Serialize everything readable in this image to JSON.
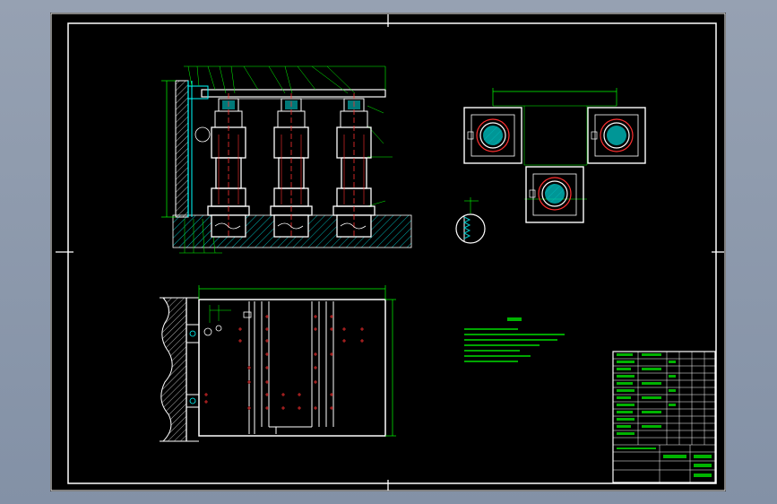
{
  "view": {
    "background": "#000000",
    "paper_frame_color": "#ffffff",
    "geometry_color": "#ffffff",
    "dimension_color": "#00ff00",
    "hidden_color": "#ff3030",
    "hatch_color": "#00c8c8",
    "highlight_color": "#ffff00"
  },
  "icons": {
    "section_detail": "circle-section-detail-icon",
    "center_marks": "center-mark-icon"
  }
}
